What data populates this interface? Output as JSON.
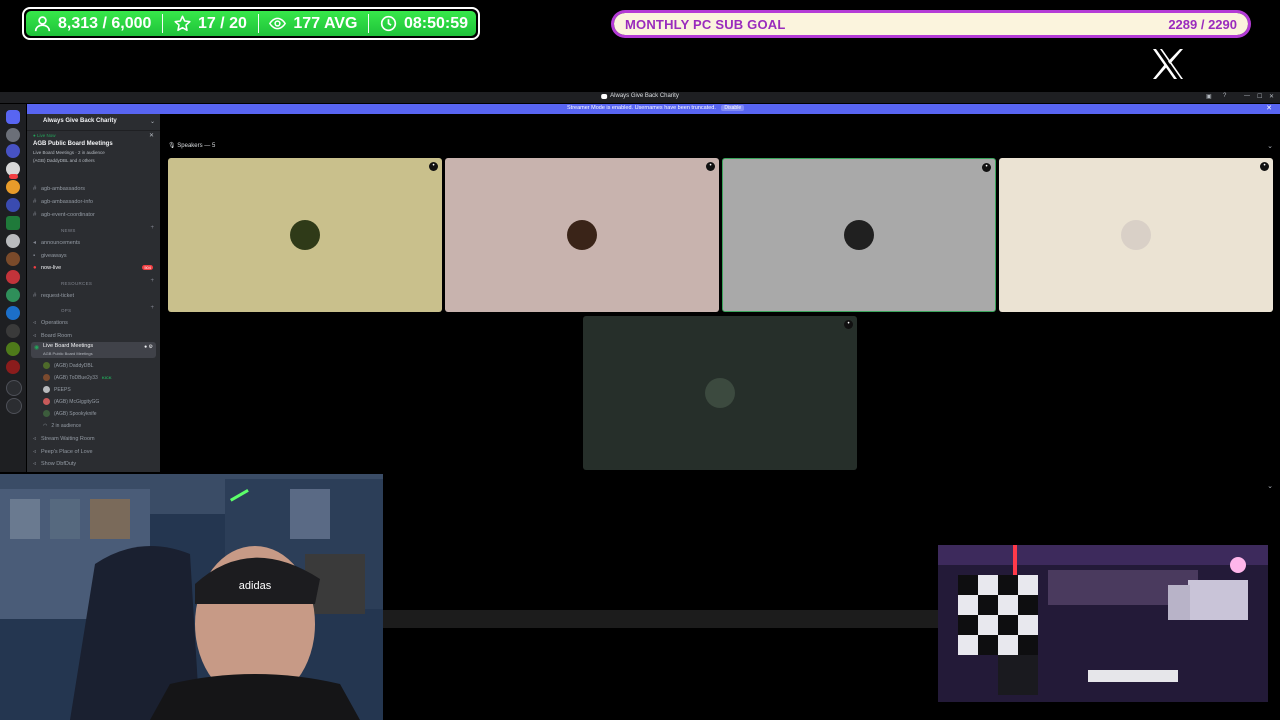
{
  "overlay": {
    "stats": {
      "followers": "8,313 / 6,000",
      "stars": "17 / 20",
      "viewers": "177 AVG",
      "uptime": "08:50:59"
    },
    "goal": {
      "title": "MONTHLY PC SUB GOAL",
      "value": "2289 / 2290",
      "progress": 0.9996
    },
    "colors": {
      "stats_green": "#27d63f",
      "goal_purple": "#b43bd6",
      "goal_fill": "#fbf4dd"
    },
    "social_icon": "x-logo"
  },
  "discord": {
    "window_title": "Always Give Back Charity",
    "banner": {
      "text": "Streamer Mode is enabled. Usernames have been truncated.",
      "button": "Disable"
    },
    "guild_name": "Always Give Back Charity",
    "live": {
      "label": "● Live Now",
      "title": "AGB Public Board Meetings",
      "sub": "Live Board Meetings · 2 in audience",
      "sub2": "(AGB) DaddyDBL and 4 others"
    },
    "channels_top": [
      "agb-ambassadors",
      "agb-ambassador-info",
      "agb-event-coordinator"
    ],
    "category_news": "NEWS",
    "channels_news": [
      "announcements",
      "giveaways",
      "now-live"
    ],
    "now_live_badge": "504",
    "category_resources": "RESOURCES",
    "channels_resources": [
      "request-ticket"
    ],
    "category_ops": "OPS",
    "channels_ops": [
      "Operations",
      "Board Room"
    ],
    "active_voice": {
      "title": "Live Board Meetings",
      "sub": "AGB Public Board Meetings"
    },
    "members": [
      "(AGB) DaddyDBL",
      "(AGB) ToDBue2y33",
      "PEEPS",
      "(AGB) McGiggityGG",
      "(AGB) Spookyknife"
    ],
    "kick_badge": "KICK",
    "audience": "2 in audience",
    "channels_bottom": [
      "Stream Waiting Room",
      "Peep's Place of Love",
      "Show DbfDuty"
    ],
    "speakers_label": "Speakers — 5",
    "tiles": [
      {
        "color": "#c9c08c",
        "avatar": "#2f3a18"
      },
      {
        "color": "#c8b3ae",
        "avatar": "#3a2418"
      },
      {
        "color": "#a9a9a9",
        "avatar": "#202020"
      },
      {
        "color": "#ebe3d3",
        "avatar": "#d9d0c7"
      },
      {
        "color": "#262f2a",
        "avatar": "#3c4a3f"
      }
    ]
  }
}
